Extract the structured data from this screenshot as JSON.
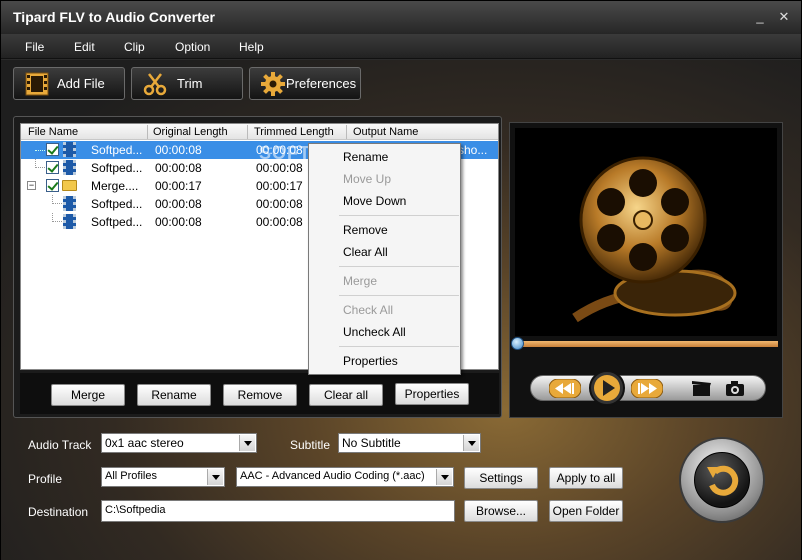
{
  "window": {
    "title": "Tipard FLV to Audio Converter",
    "minimize_glyph": "_",
    "close_glyph": "✕"
  },
  "menu": [
    "File",
    "Edit",
    "Clip",
    "Option",
    "Help"
  ],
  "toolbar": {
    "add_file": "Add File",
    "trim": "Trim",
    "preferences": "Preferences"
  },
  "file_list": {
    "columns": [
      "File Name",
      "Original Length",
      "Trimmed Length",
      "Output Name"
    ],
    "rows": [
      {
        "name": "Softped...",
        "original": "00:00:08",
        "trimmed": "00:00:08",
        "output": "sho...",
        "selected": true,
        "type": "video",
        "checked": true
      },
      {
        "name": "Softped...",
        "original": "00:00:08",
        "trimmed": "00:00:08",
        "output": "",
        "selected": false,
        "type": "video",
        "checked": true
      },
      {
        "name": "Merge....",
        "original": "00:00:17",
        "trimmed": "00:00:17",
        "output": "",
        "selected": false,
        "type": "folder",
        "checked": true
      },
      {
        "name": "Softped...",
        "original": "00:00:08",
        "trimmed": "00:00:08",
        "output": "",
        "selected": false,
        "type": "video",
        "checked": false
      },
      {
        "name": "Softped...",
        "original": "00:00:08",
        "trimmed": "00:00:08",
        "output": "",
        "selected": false,
        "type": "video",
        "checked": false
      }
    ],
    "expander_glyph": "−"
  },
  "list_buttons": {
    "merge": "Merge",
    "rename": "Rename",
    "remove": "Remove",
    "clear_all": "Clear all",
    "properties": "Properties"
  },
  "context_menu": [
    {
      "label": "Rename",
      "enabled": true
    },
    {
      "label": "Move Up",
      "enabled": false
    },
    {
      "label": "Move Down",
      "enabled": true
    },
    {
      "label": "Remove",
      "enabled": true
    },
    {
      "label": "Clear All",
      "enabled": true
    },
    {
      "label": "Merge",
      "enabled": false
    },
    {
      "label": "Check All",
      "enabled": false
    },
    {
      "label": "Uncheck All",
      "enabled": true
    },
    {
      "label": "Properties",
      "enabled": true
    }
  ],
  "watermark": "SOFTPEDIA",
  "settings": {
    "audio_track_label": "Audio Track",
    "audio_track_value": "0x1 aac stereo",
    "subtitle_label": "Subtitle",
    "subtitle_value": "No Subtitle",
    "profile_label": "Profile",
    "profile_category": "All Profiles",
    "profile_value": "AAC - Advanced Audio Coding (*.aac)",
    "settings_button": "Settings",
    "apply_to_all_button": "Apply to all",
    "destination_label": "Destination",
    "destination_value": "C:\\Softpedia",
    "browse_button": "Browse...",
    "open_folder_button": "Open Folder"
  },
  "player": {
    "progress": 0.0
  },
  "colors": {
    "selection": "#3a8ee6",
    "accent_gold": "#e8a93a"
  }
}
